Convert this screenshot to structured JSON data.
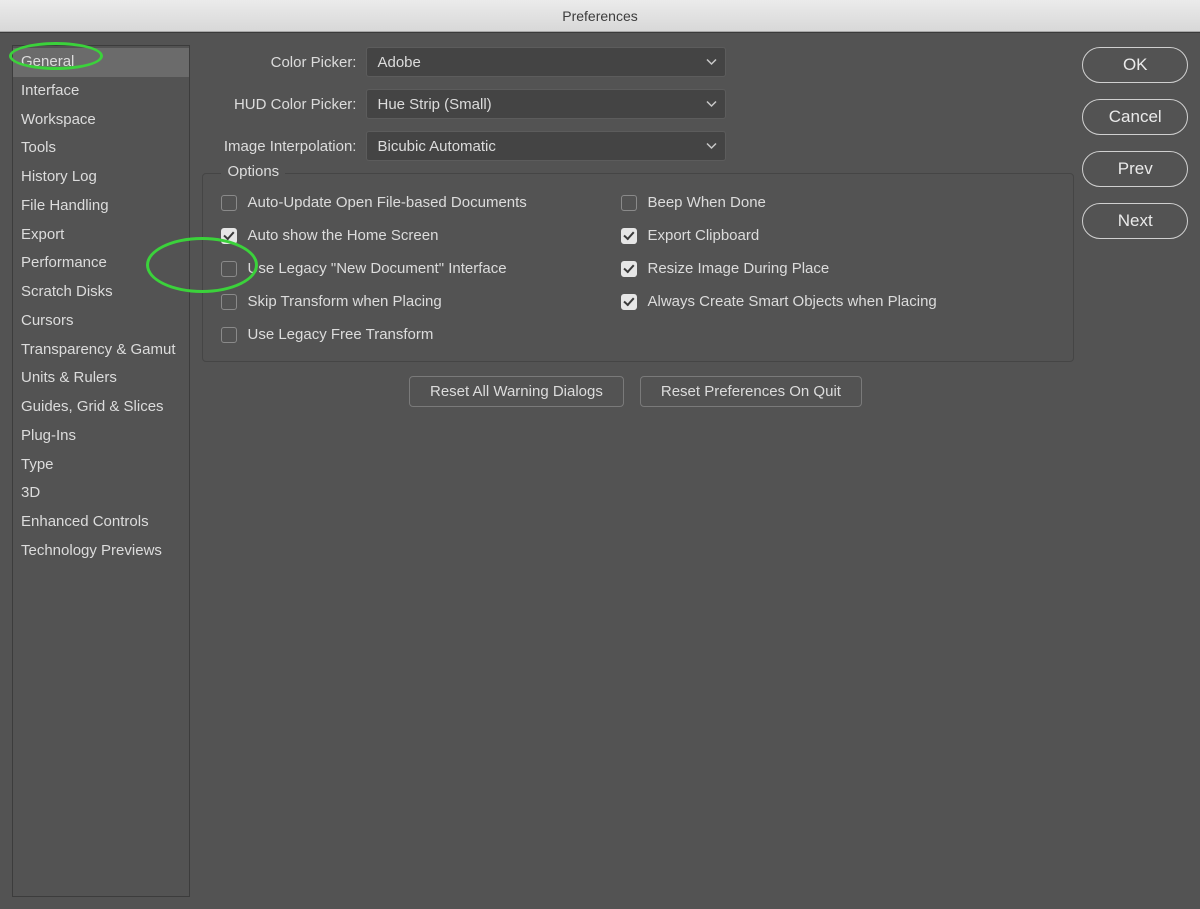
{
  "title": "Preferences",
  "sidebar": {
    "items": [
      {
        "label": "General",
        "selected": true
      },
      {
        "label": "Interface"
      },
      {
        "label": "Workspace"
      },
      {
        "label": "Tools"
      },
      {
        "label": "History Log"
      },
      {
        "label": "File Handling"
      },
      {
        "label": "Export"
      },
      {
        "label": "Performance"
      },
      {
        "label": "Scratch Disks"
      },
      {
        "label": "Cursors"
      },
      {
        "label": "Transparency & Gamut"
      },
      {
        "label": "Units & Rulers"
      },
      {
        "label": "Guides, Grid & Slices"
      },
      {
        "label": "Plug-Ins"
      },
      {
        "label": "Type"
      },
      {
        "label": "3D"
      },
      {
        "label": "Enhanced Controls"
      },
      {
        "label": "Technology Previews"
      }
    ]
  },
  "form": {
    "color_picker": {
      "label": "Color Picker:",
      "value": "Adobe"
    },
    "hud_color_picker": {
      "label": "HUD Color Picker:",
      "value": "Hue Strip (Small)"
    },
    "image_interpolation": {
      "label": "Image Interpolation:",
      "value": "Bicubic Automatic"
    }
  },
  "options": {
    "legend": "Options",
    "left": [
      {
        "label": "Auto-Update Open File-based Documents",
        "checked": false
      },
      {
        "label": "Auto show the Home Screen",
        "checked": true
      },
      {
        "label": "Use Legacy \"New Document\" Interface",
        "checked": false
      },
      {
        "label": "Skip Transform when Placing",
        "checked": false
      },
      {
        "label": "Use Legacy Free Transform",
        "checked": false
      }
    ],
    "right": [
      {
        "label": "Beep When Done",
        "checked": false
      },
      {
        "label": "Export Clipboard",
        "checked": true
      },
      {
        "label": "Resize Image During Place",
        "checked": true
      },
      {
        "label": "Always Create Smart Objects when Placing",
        "checked": true
      }
    ]
  },
  "bottom_buttons": {
    "reset_warnings": "Reset All Warning Dialogs",
    "reset_prefs": "Reset Preferences On Quit"
  },
  "right_buttons": {
    "ok": "OK",
    "cancel": "Cancel",
    "prev": "Prev",
    "next": "Next"
  }
}
